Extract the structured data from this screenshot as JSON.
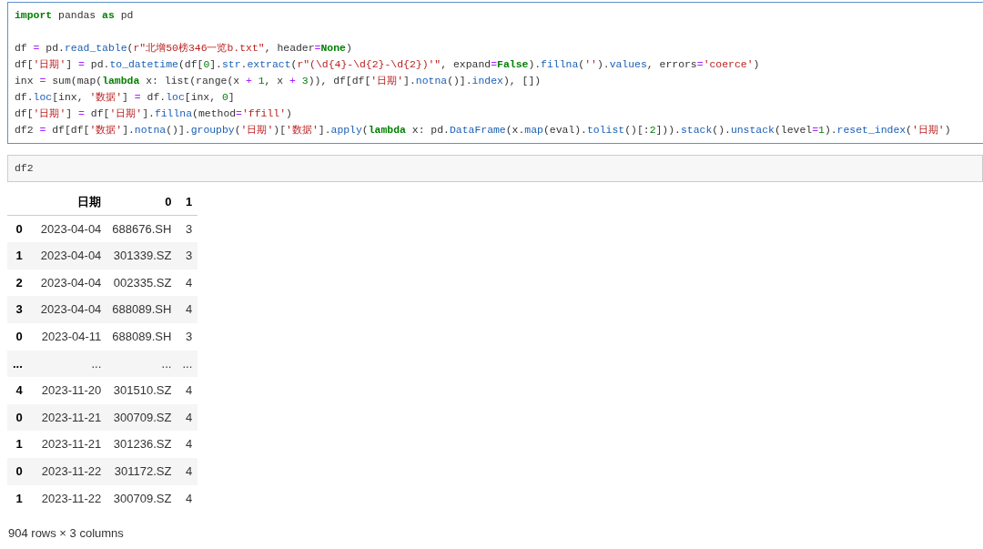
{
  "code_cell": {
    "selected": true,
    "paragraphs": [
      [
        [
          {
            "kind": "kw",
            "text": "import"
          },
          {
            "kind": "p",
            "text": " pandas "
          },
          {
            "kind": "kw",
            "text": "as"
          },
          {
            "kind": "p",
            "text": " pd"
          }
        ]
      ],
      [
        [
          {
            "kind": "p",
            "text": "df "
          },
          {
            "kind": "op",
            "text": "="
          },
          {
            "kind": "p",
            "text": " pd."
          },
          {
            "kind": "fn",
            "text": "read_table"
          },
          {
            "kind": "p",
            "text": "("
          },
          {
            "kind": "str",
            "text": "r\"北增50榜346一览b.txt\""
          },
          {
            "kind": "p",
            "text": ", header"
          },
          {
            "kind": "op",
            "text": "="
          },
          {
            "kind": "kw",
            "text": "None"
          },
          {
            "kind": "p",
            "text": ")"
          }
        ],
        [
          {
            "kind": "p",
            "text": "df["
          },
          {
            "kind": "str",
            "text": "'日期'"
          },
          {
            "kind": "p",
            "text": "] "
          },
          {
            "kind": "op",
            "text": "="
          },
          {
            "kind": "p",
            "text": " pd."
          },
          {
            "kind": "fn",
            "text": "to_datetime"
          },
          {
            "kind": "p",
            "text": "(df["
          },
          {
            "kind": "num",
            "text": "0"
          },
          {
            "kind": "p",
            "text": "]."
          },
          {
            "kind": "fn",
            "text": "str"
          },
          {
            "kind": "p",
            "text": "."
          },
          {
            "kind": "fn",
            "text": "extract"
          },
          {
            "kind": "p",
            "text": "("
          },
          {
            "kind": "str",
            "text": "r\"(\\d{4}-\\d{2}-\\d{2})'\""
          },
          {
            "kind": "p",
            "text": ", expand"
          },
          {
            "kind": "op",
            "text": "="
          },
          {
            "kind": "kw",
            "text": "False"
          },
          {
            "kind": "p",
            "text": ")."
          },
          {
            "kind": "fn",
            "text": "fillna"
          },
          {
            "kind": "p",
            "text": "("
          },
          {
            "kind": "str",
            "text": "''"
          },
          {
            "kind": "p",
            "text": ")."
          },
          {
            "kind": "fn",
            "text": "values"
          },
          {
            "kind": "p",
            "text": ", errors"
          },
          {
            "kind": "op",
            "text": "="
          },
          {
            "kind": "str",
            "text": "'coerce'"
          },
          {
            "kind": "p",
            "text": ")"
          }
        ],
        [
          {
            "kind": "p",
            "text": "inx "
          },
          {
            "kind": "op",
            "text": "="
          },
          {
            "kind": "p",
            "text": " sum(map("
          },
          {
            "kind": "kw",
            "text": "lambda"
          },
          {
            "kind": "p",
            "text": " x: list(range(x "
          },
          {
            "kind": "op",
            "text": "+"
          },
          {
            "kind": "num",
            "text": " 1"
          },
          {
            "kind": "p",
            "text": ", x "
          },
          {
            "kind": "op",
            "text": "+"
          },
          {
            "kind": "num",
            "text": " 3"
          },
          {
            "kind": "p",
            "text": ")), df[df["
          },
          {
            "kind": "str",
            "text": "'日期'"
          },
          {
            "kind": "p",
            "text": "]."
          },
          {
            "kind": "fn",
            "text": "notna"
          },
          {
            "kind": "p",
            "text": "()]."
          },
          {
            "kind": "fn",
            "text": "index"
          },
          {
            "kind": "p",
            "text": "), [])"
          }
        ],
        [
          {
            "kind": "p",
            "text": "df."
          },
          {
            "kind": "fn",
            "text": "loc"
          },
          {
            "kind": "p",
            "text": "[inx, "
          },
          {
            "kind": "str",
            "text": "'数据'"
          },
          {
            "kind": "p",
            "text": "] "
          },
          {
            "kind": "op",
            "text": "="
          },
          {
            "kind": "p",
            "text": " df."
          },
          {
            "kind": "fn",
            "text": "loc"
          },
          {
            "kind": "p",
            "text": "[inx, "
          },
          {
            "kind": "num",
            "text": "0"
          },
          {
            "kind": "p",
            "text": "]"
          }
        ],
        [
          {
            "kind": "p",
            "text": "df["
          },
          {
            "kind": "str",
            "text": "'日期'"
          },
          {
            "kind": "p",
            "text": "] "
          },
          {
            "kind": "op",
            "text": "="
          },
          {
            "kind": "p",
            "text": " df["
          },
          {
            "kind": "str",
            "text": "'日期'"
          },
          {
            "kind": "p",
            "text": "]."
          },
          {
            "kind": "fn",
            "text": "fillna"
          },
          {
            "kind": "p",
            "text": "(method"
          },
          {
            "kind": "op",
            "text": "="
          },
          {
            "kind": "str",
            "text": "'ffill'"
          },
          {
            "kind": "p",
            "text": ")"
          }
        ],
        [
          {
            "kind": "p",
            "text": "df2 "
          },
          {
            "kind": "op",
            "text": "="
          },
          {
            "kind": "p",
            "text": " df[df["
          },
          {
            "kind": "str",
            "text": "'数据'"
          },
          {
            "kind": "p",
            "text": "]."
          },
          {
            "kind": "fn",
            "text": "notna"
          },
          {
            "kind": "p",
            "text": "()]."
          },
          {
            "kind": "fn",
            "text": "groupby"
          },
          {
            "kind": "p",
            "text": "("
          },
          {
            "kind": "str",
            "text": "'日期'"
          },
          {
            "kind": "p",
            "text": ")["
          },
          {
            "kind": "str",
            "text": "'数据'"
          },
          {
            "kind": "p",
            "text": "]."
          },
          {
            "kind": "fn",
            "text": "apply"
          },
          {
            "kind": "p",
            "text": "("
          },
          {
            "kind": "kw",
            "text": "lambda"
          },
          {
            "kind": "p",
            "text": " x: pd."
          },
          {
            "kind": "fn",
            "text": "DataFrame"
          },
          {
            "kind": "p",
            "text": "(x."
          },
          {
            "kind": "fn",
            "text": "map"
          },
          {
            "kind": "p",
            "text": "(eval)."
          },
          {
            "kind": "fn",
            "text": "tolist"
          },
          {
            "kind": "p",
            "text": "()[:"
          },
          {
            "kind": "num",
            "text": "2"
          },
          {
            "kind": "p",
            "text": "]))."
          },
          {
            "kind": "fn",
            "text": "stack"
          },
          {
            "kind": "p",
            "text": "()."
          },
          {
            "kind": "fn",
            "text": "unstack"
          },
          {
            "kind": "p",
            "text": "(level"
          },
          {
            "kind": "op",
            "text": "="
          },
          {
            "kind": "num",
            "text": "1"
          },
          {
            "kind": "p",
            "text": ")."
          },
          {
            "kind": "fn",
            "text": "reset_index"
          },
          {
            "kind": "p",
            "text": "("
          },
          {
            "kind": "str",
            "text": "'日期'"
          },
          {
            "kind": "p",
            "text": ")"
          }
        ]
      ]
    ]
  },
  "input_cell": {
    "selected": false,
    "code": "df2"
  },
  "table": {
    "columns": [
      "日期",
      "0",
      "1"
    ],
    "rows": [
      {
        "index": "0",
        "cells": [
          "2023-04-04",
          "688676.SH",
          "3"
        ]
      },
      {
        "index": "1",
        "cells": [
          "2023-04-04",
          "301339.SZ",
          "3"
        ]
      },
      {
        "index": "2",
        "cells": [
          "2023-04-04",
          "002335.SZ",
          "4"
        ]
      },
      {
        "index": "3",
        "cells": [
          "2023-04-04",
          "688089.SH",
          "4"
        ]
      },
      {
        "index": "0",
        "cells": [
          "2023-04-11",
          "688089.SH",
          "3"
        ]
      },
      {
        "index": "...",
        "cells": [
          "...",
          "...",
          "..."
        ]
      },
      {
        "index": "4",
        "cells": [
          "2023-11-20",
          "301510.SZ",
          "4"
        ]
      },
      {
        "index": "0",
        "cells": [
          "2023-11-21",
          "300709.SZ",
          "4"
        ]
      },
      {
        "index": "1",
        "cells": [
          "2023-11-21",
          "301236.SZ",
          "4"
        ]
      },
      {
        "index": "0",
        "cells": [
          "2023-11-22",
          "301172.SZ",
          "4"
        ]
      },
      {
        "index": "1",
        "cells": [
          "2023-11-22",
          "300709.SZ",
          "4"
        ]
      }
    ]
  },
  "table_shape": "904 rows × 3 columns"
}
